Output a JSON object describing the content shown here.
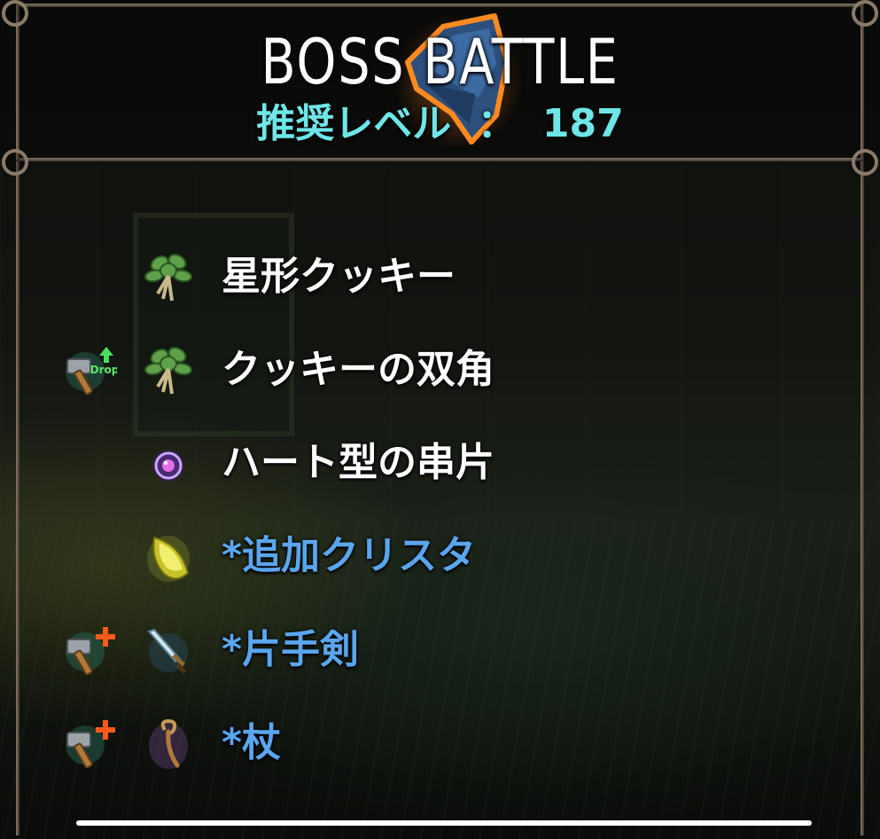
{
  "header": {
    "title": "BOSS BATTLE",
    "level_label": "推奨レベル",
    "level_separator": "：",
    "level_value": "187",
    "emblem_icon": "boss-helmet-icon"
  },
  "colors": {
    "title": "#ffffff",
    "level": "#6ee6e8",
    "item_normal": "#ffffff",
    "item_extra": "#5aa6ee"
  },
  "rewards": [
    {
      "name": "星形クッキー",
      "icon": "herb-leaf-icon",
      "flag": null,
      "extra": false
    },
    {
      "name": "クッキーの双角",
      "icon": "herb-leaf-icon",
      "flag": "drop-up-hammer-icon",
      "flag_text": "Drop",
      "extra": false
    },
    {
      "name": "ハート型の串片",
      "icon": "purple-orb-icon",
      "flag": null,
      "extra": false
    },
    {
      "name": "*追加クリスタ",
      "icon": "yellow-crystal-icon",
      "flag": null,
      "extra": true
    },
    {
      "name": "*片手剣",
      "icon": "one-handed-sword-icon",
      "flag": "smith-plus-hammer-icon",
      "extra": true
    },
    {
      "name": "*杖",
      "icon": "staff-icon",
      "flag": "smith-plus-hammer-icon",
      "extra": true
    }
  ]
}
